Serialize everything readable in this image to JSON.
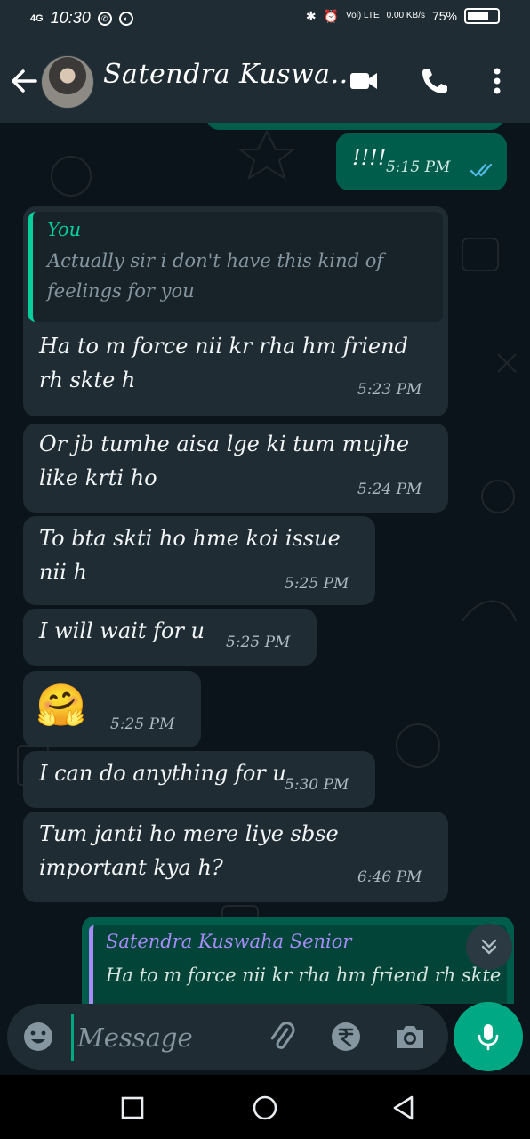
{
  "status_bar": {
    "network": "4G",
    "time": "10:30",
    "volte": "Vol) LTE",
    "speed": "0.00 KB/s",
    "battery_text": "75%",
    "battery_level": 0.75
  },
  "header": {
    "contact_name": "Satendra Kuswa...",
    "icons": [
      "back-arrow-icon",
      "video-call-icon",
      "voice-call-icon",
      "more-vert-icon"
    ]
  },
  "messages": {
    "m0": {
      "text": "!!!!",
      "time": "5:15 PM",
      "ticks": "read"
    },
    "m1": {
      "quote_name": "You",
      "quote_text": "Actually sir i don't have this kind of feelings for you",
      "text": "Ha to m force nii kr rha hm friend rh skte h",
      "time": "5:23 PM"
    },
    "m2": {
      "text": "Or jb tumhe aisa lge ki tum mujhe like krti ho",
      "time": "5:24 PM"
    },
    "m3": {
      "text": "To bta skti ho hme koi issue nii h",
      "time": "5:25 PM"
    },
    "m4": {
      "text": "I will wait for u",
      "time": "5:25 PM"
    },
    "m5": {
      "emoji": "🤗",
      "time": "5:25 PM"
    },
    "m6": {
      "text": "I can do anything for u",
      "time": "5:30 PM"
    },
    "m7": {
      "text": "Tum janti ho mere liye sbse important kya h?",
      "time": "6:46 PM"
    }
  },
  "reply_preview": {
    "name": "Satendra Kuswaha Senior",
    "text": "Ha to m force nii kr rha hm friend rh skte"
  },
  "composer": {
    "placeholder": "Message",
    "icons": [
      "emoji-icon",
      "attach-icon",
      "rupee-payment-icon",
      "camera-icon",
      "mic-icon"
    ]
  },
  "colors": {
    "background": "#0b141a",
    "header": "#1f2c33",
    "incoming_bubble": "#1f2c33",
    "outgoing_bubble": "#005c4b",
    "accent": "#00a884",
    "read_ticks": "#53bdeb"
  }
}
